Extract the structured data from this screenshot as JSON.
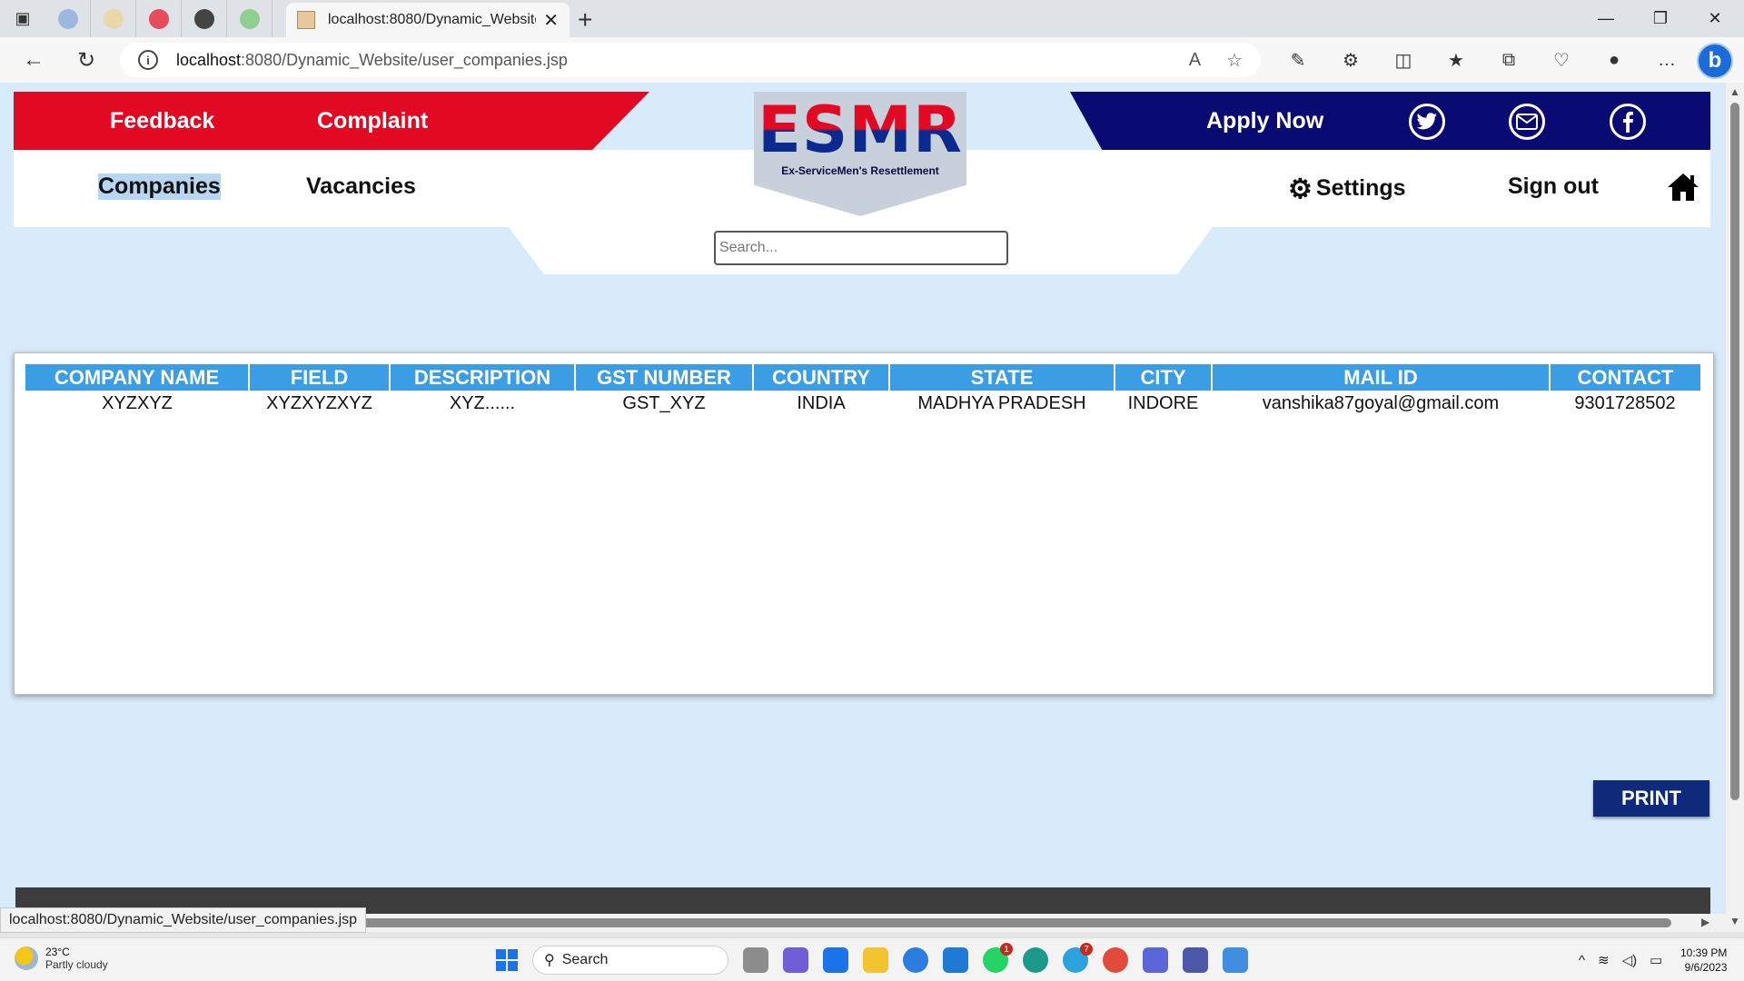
{
  "browser": {
    "active_tab_title": "localhost:8080/Dynamic_Website",
    "url_host": "localhost",
    "url_rest": ":8080/Dynamic_Website/user_companies.jsp",
    "status_url": "localhost:8080/Dynamic_Website/user_companies.jsp",
    "bing_label": "b"
  },
  "header": {
    "feedback": "Feedback",
    "complaint": "Complaint",
    "apply_now": "Apply Now",
    "logo_word": "ESMR",
    "logo_sub": "Ex-ServiceMen's Resettlement",
    "colors": {
      "red": "#e10a22",
      "navy": "#0a0a73",
      "table_header": "#3b9de3",
      "page_bg": "#d8ebfb"
    }
  },
  "nav": {
    "companies": "Companies",
    "vacancies": "Vacancies",
    "settings": "Settings",
    "sign_out": "Sign out"
  },
  "search": {
    "placeholder": "Search..."
  },
  "table": {
    "headers": [
      "COMPANY NAME",
      "FIELD",
      "DESCRIPTION",
      "GST NUMBER",
      "COUNTRY",
      "STATE",
      "CITY",
      "MAIL ID",
      "CONTACT"
    ],
    "rows": [
      [
        "XYZXYZ",
        "XYZXYZXYZ",
        "XYZ......",
        "GST_XYZ",
        "INDIA",
        "MADHYA PRADESH",
        "INDORE",
        "vanshika87goyal@gmail.com",
        "9301728502"
      ]
    ]
  },
  "print_label": "PRINT",
  "taskbar": {
    "temperature": "23°C",
    "weather": "Partly cloudy",
    "search_label": "Search",
    "time": "10:39 PM",
    "date": "9/6/2023",
    "whatsapp_badge": "1",
    "telegram_badge": "7"
  }
}
